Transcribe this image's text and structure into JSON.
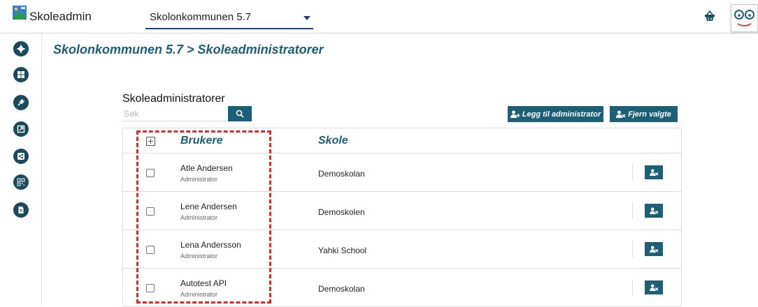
{
  "header": {
    "app_title": "Skoleadmin",
    "municipality_selected": "Skolonkommunen 5.7"
  },
  "page": {
    "breadcrumb": "Skolonkommunen 5.7 > Skoleadministratorer"
  },
  "section": {
    "title": "Skoleadministratorer",
    "search_placeholder": "Søk",
    "add_button_label": "Legg til administrator",
    "remove_selected_label": "Fjern valgte"
  },
  "table": {
    "headers": {
      "users": "Brukere",
      "school": "Skole"
    },
    "rows": [
      {
        "name": "Atle Andersen",
        "role": "Administrator",
        "school": "Demoskolan"
      },
      {
        "name": "Lene Andersen",
        "role": "Administrator",
        "school": "Demoskolen"
      },
      {
        "name": "Lena Andersson",
        "role": "Administrator",
        "school": "Yahki School"
      },
      {
        "name": "Autotest API",
        "role": "Administrator",
        "school": "Demoskolan"
      }
    ]
  },
  "colors": {
    "accent": "#1b6076",
    "sidebar_icon_bg": "#1b4a5c",
    "highlight_dashed": "#e02828"
  },
  "icons": {
    "sidebar": [
      "gear-icon",
      "grid-icon",
      "plug-icon",
      "external-link-icon",
      "share-icon",
      "qr-code-icon",
      "document-icon"
    ],
    "search": "search-icon",
    "add_user": "user-plus-icon",
    "remove_user": "user-x-icon",
    "basket": "basket-icon"
  }
}
